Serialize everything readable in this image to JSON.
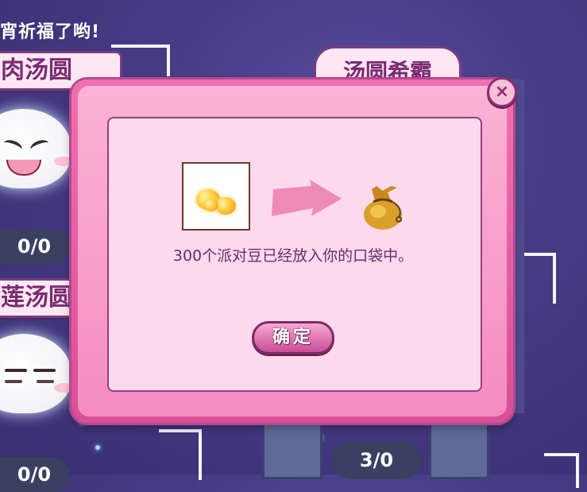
{
  "background": {
    "top_text": "宵祈福了哟!",
    "left_banner_1": "肉汤圆",
    "left_banner_2": "莲汤圆",
    "left_counter_1": "0/0",
    "left_counter_2": "0/0",
    "center_label": "汤圆希霸",
    "bottom_counter": "3/0"
  },
  "modal": {
    "close_label": "×",
    "message": "300个派对豆已经放入你的口袋中。",
    "confirm_label": "确定"
  },
  "colors": {
    "accent_pink": "#f16fb0",
    "panel_bg": "#fcd9ec",
    "text_purple": "#6b2c6e"
  }
}
